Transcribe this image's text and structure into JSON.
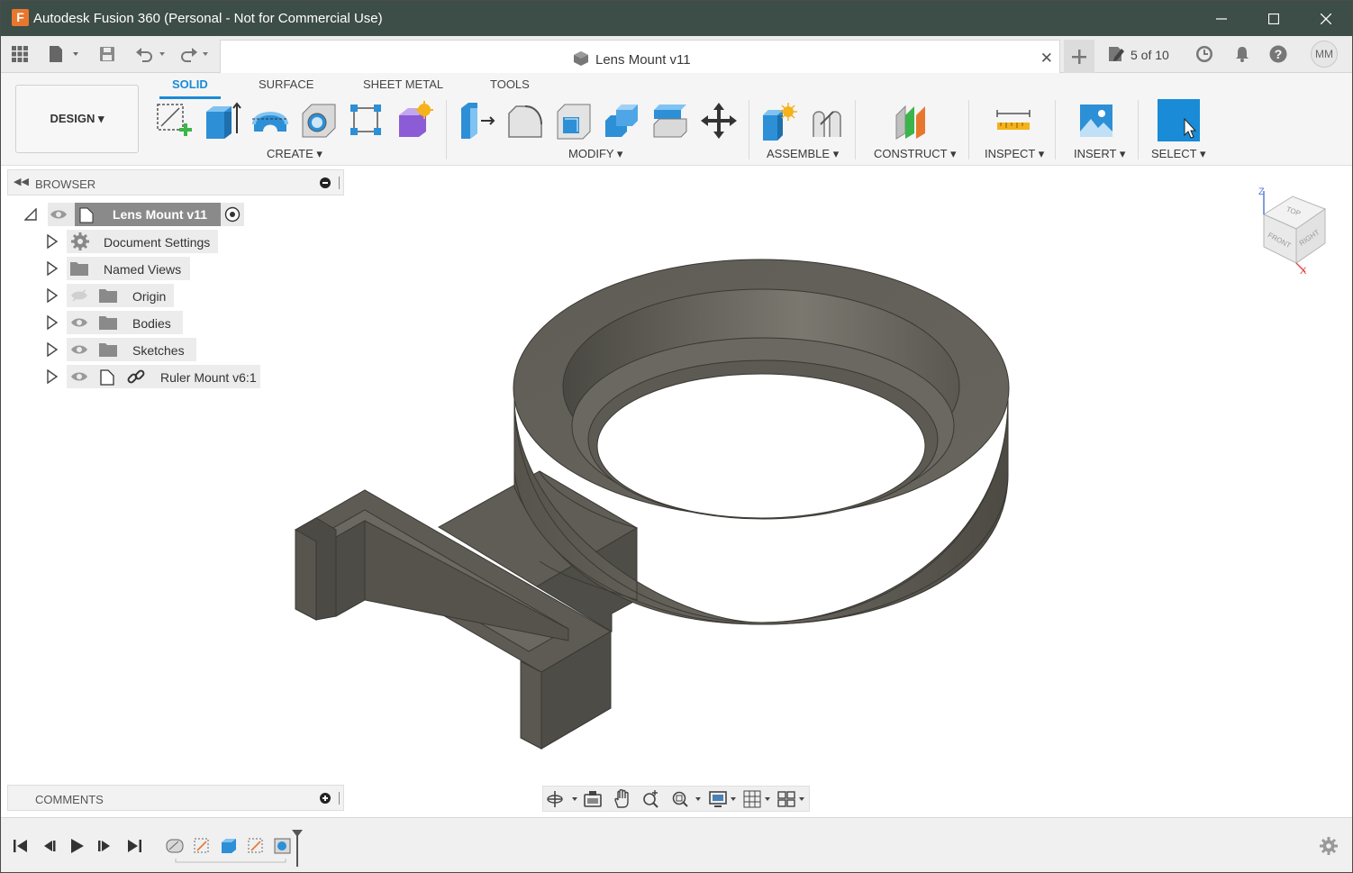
{
  "titlebar": {
    "title": "Autodesk Fusion 360 (Personal - Not for Commercial Use)",
    "logo_letter": "F",
    "minimize_icon": "minimize-icon",
    "maximize_icon": "maximize-icon",
    "close_icon": "close-icon"
  },
  "tabbar": {
    "document_tab_label": "Lens Mount v11",
    "version_label": "5 of 10",
    "user_initials": "MM"
  },
  "ribbon": {
    "workspace_label": "DESIGN ▾",
    "tabs": [
      {
        "label": "SOLID",
        "active": true
      },
      {
        "label": "SURFACE",
        "active": false
      },
      {
        "label": "SHEET METAL",
        "active": false
      },
      {
        "label": "TOOLS",
        "active": false
      }
    ],
    "groups": {
      "create": "CREATE ▾",
      "modify": "MODIFY ▾",
      "assemble": "ASSEMBLE ▾",
      "construct": "CONSTRUCT ▾",
      "inspect": "INSPECT ▾",
      "insert": "INSERT ▾",
      "select": "SELECT ▾"
    },
    "accent_color": "#1a8bd6"
  },
  "browser": {
    "title": "BROWSER",
    "root": "Lens Mount v11",
    "items": [
      {
        "label": "Document Settings"
      },
      {
        "label": "Named Views"
      },
      {
        "label": "Origin"
      },
      {
        "label": "Bodies"
      },
      {
        "label": "Sketches"
      },
      {
        "label": "Ruler Mount v6:1"
      }
    ]
  },
  "comments": {
    "title": "COMMENTS"
  },
  "viewcube": {
    "top": "TOP",
    "front": "FRONT",
    "right": "RIGHT",
    "axis_z": "Z",
    "axis_x": "X"
  }
}
